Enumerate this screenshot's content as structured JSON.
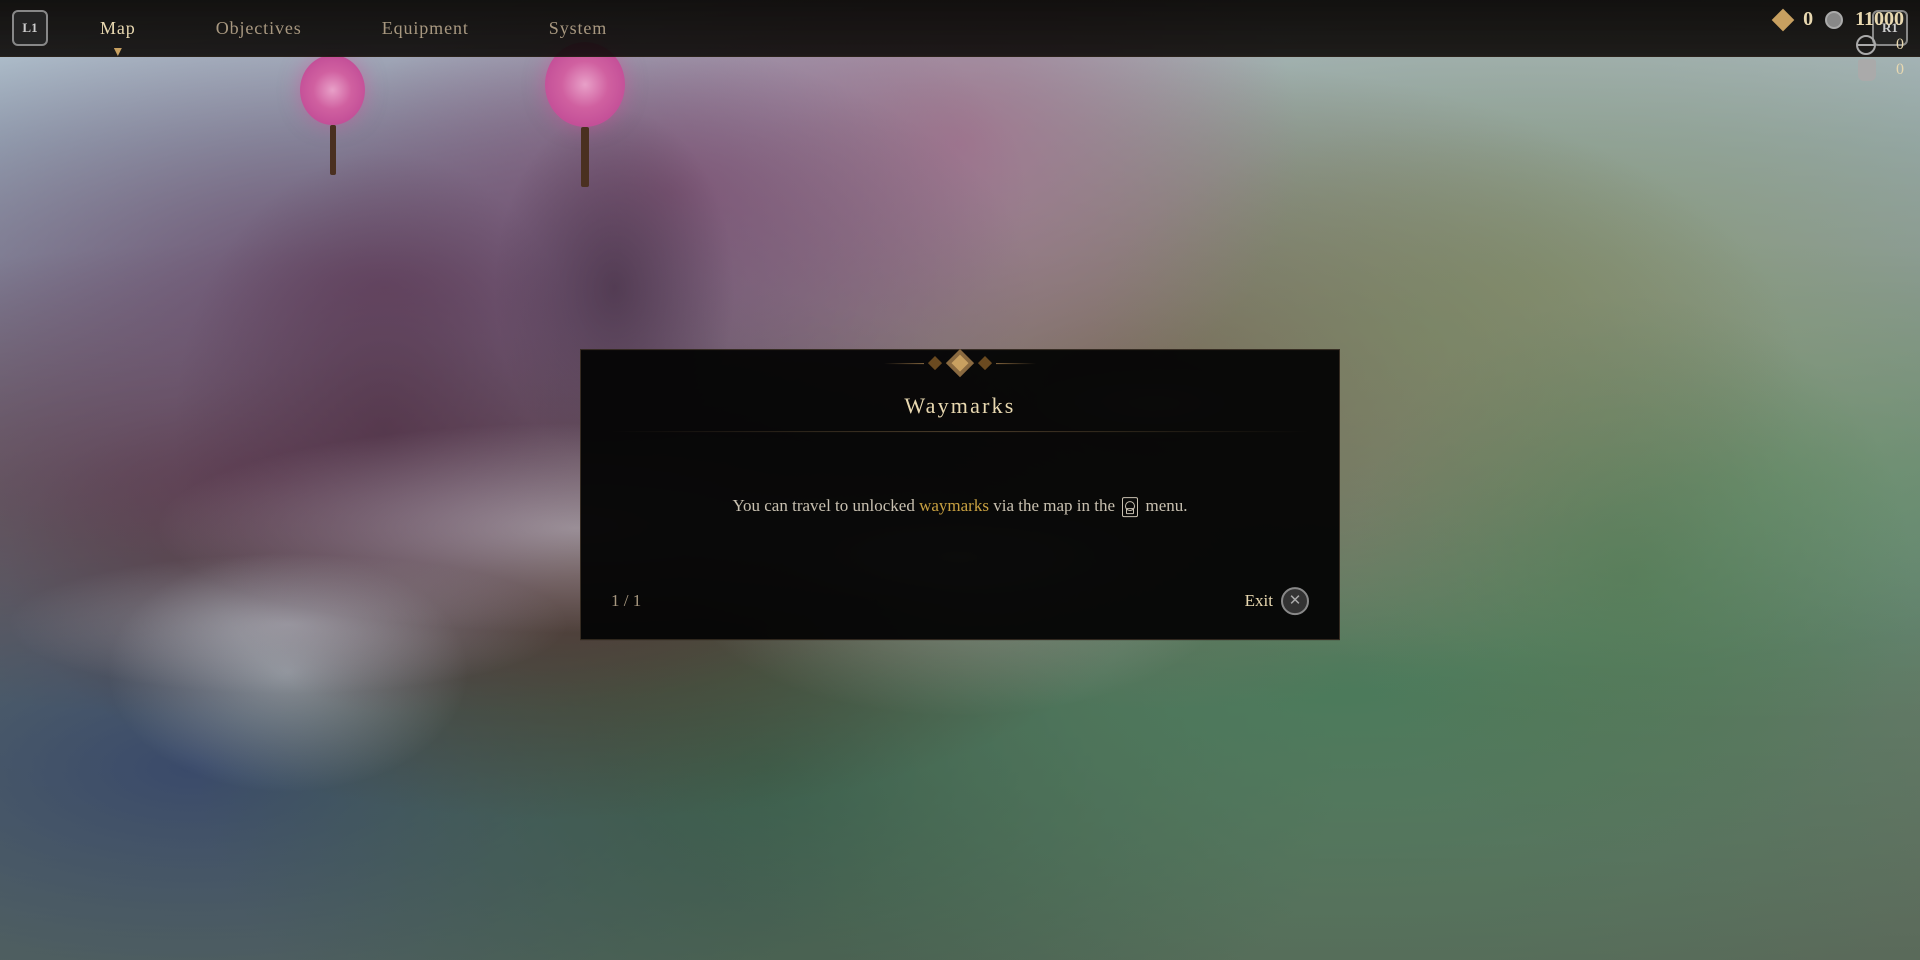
{
  "nav": {
    "left_btn": "L1",
    "right_btn": "R1",
    "tabs": [
      {
        "id": "map",
        "label": "Map",
        "active": true
      },
      {
        "id": "objectives",
        "label": "Objectives",
        "active": false
      },
      {
        "id": "equipment",
        "label": "Equipment",
        "active": false
      },
      {
        "id": "system",
        "label": "System",
        "active": false
      }
    ]
  },
  "hud": {
    "diamond_value": "0",
    "record_value": "11000",
    "globe_count": "0",
    "pouch_count": "0"
  },
  "dialog": {
    "title": "Waymarks",
    "body_plain_start": "You can travel to unlocked ",
    "body_waymarks": "waymarks",
    "body_plain_end": " via the map in the",
    "body_menu_suffix": "menu.",
    "pagination": "1 / 1",
    "exit_label": "Exit"
  }
}
